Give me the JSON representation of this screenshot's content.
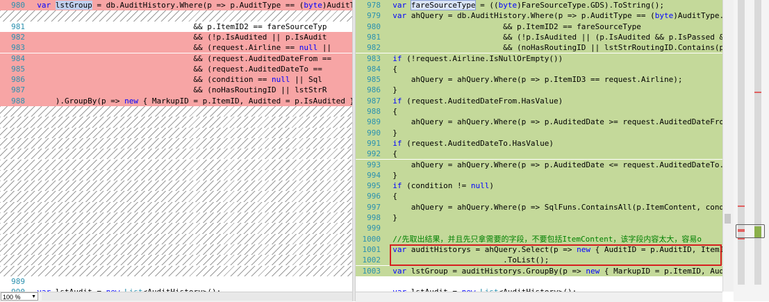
{
  "left": {
    "rows": [
      {
        "num": "980",
        "type": "del",
        "tokens": [
          [
            "  "
          ],
          [
            "var",
            "kw"
          ],
          [
            " "
          ],
          [
            "lstGroup",
            "hl"
          ],
          [
            " = db.AuditHistory.Where(p => p.AuditType == ("
          ],
          [
            "byte",
            "kw"
          ],
          [
            ")AuditTy"
          ]
        ]
      },
      {
        "num": "",
        "type": "hatch",
        "tokens": []
      },
      {
        "num": "981",
        "type": "",
        "tokens": [
          [
            "                                    && p.ItemID2 == fareSourceTyp"
          ]
        ]
      },
      {
        "num": "982",
        "type": "del",
        "tokens": [
          [
            "                                    && (!p.IsAudited || p.IsAudit"
          ]
        ]
      },
      {
        "num": "983",
        "type": "del",
        "tokens": [
          [
            "                                    && (request.Airline == "
          ],
          [
            "null",
            "kw"
          ],
          [
            " ||"
          ]
        ]
      },
      {
        "num": "984",
        "type": "del",
        "tokens": [
          [
            "                                    && (request.AuditedDateFrom =="
          ]
        ]
      },
      {
        "num": "985",
        "type": "del",
        "tokens": [
          [
            "                                    && (request.AuditedDateTo == "
          ]
        ]
      },
      {
        "num": "986",
        "type": "del",
        "tokens": [
          [
            "                                    && (condition == "
          ],
          [
            "null",
            "kw"
          ],
          [
            " || Sql"
          ]
        ]
      },
      {
        "num": "987",
        "type": "del",
        "tokens": [
          [
            "                                    && (noHasRoutingID || lstStrR"
          ]
        ]
      },
      {
        "num": "988",
        "type": "del",
        "tokens": [
          [
            "      ).GroupBy(p => "
          ],
          [
            "new",
            "kw"
          ],
          [
            " { MarkupID = p.ItemID, Audited = p.IsAudited })"
          ]
        ]
      },
      {
        "num": "",
        "type": "hatch",
        "tokens": []
      },
      {
        "num": "",
        "type": "hatch",
        "tokens": []
      },
      {
        "num": "",
        "type": "hatch",
        "tokens": []
      },
      {
        "num": "",
        "type": "hatch",
        "tokens": []
      },
      {
        "num": "",
        "type": "hatch",
        "tokens": []
      },
      {
        "num": "",
        "type": "hatch",
        "tokens": []
      },
      {
        "num": "",
        "type": "hatch",
        "tokens": []
      },
      {
        "num": "",
        "type": "hatch",
        "tokens": []
      },
      {
        "num": "",
        "type": "hatch",
        "tokens": []
      },
      {
        "num": "",
        "type": "hatch",
        "tokens": []
      },
      {
        "num": "",
        "type": "hatch",
        "tokens": []
      },
      {
        "num": "",
        "type": "hatch",
        "tokens": []
      },
      {
        "num": "",
        "type": "hatch",
        "tokens": []
      },
      {
        "num": "",
        "type": "hatch",
        "tokens": []
      },
      {
        "num": "",
        "type": "hatch",
        "tokens": []
      },
      {
        "num": "",
        "type": "hatch",
        "tokens": []
      },
      {
        "num": "989",
        "type": "",
        "tokens": [
          [
            ""
          ]
        ]
      },
      {
        "num": "990",
        "type": "",
        "tokens": [
          [
            "  "
          ],
          [
            "var",
            "kw"
          ],
          [
            " lstAudit = "
          ],
          [
            "new",
            "kw"
          ],
          [
            " "
          ],
          [
            "List",
            "ty"
          ],
          [
            "<AuditHistory>();"
          ]
        ]
      }
    ]
  },
  "right": {
    "rows": [
      {
        "num": "978",
        "type": "add",
        "tokens": [
          [
            "  "
          ],
          [
            "var",
            "kw"
          ],
          [
            " "
          ],
          [
            "fareSourceType",
            "hlbox"
          ],
          [
            " = (("
          ],
          [
            "byte",
            "kw"
          ],
          [
            ")FareSourceType.GDS).ToString();"
          ]
        ]
      },
      {
        "num": "979",
        "type": "add",
        "tokens": [
          [
            "  "
          ],
          [
            "var",
            "kw"
          ],
          [
            " ahQuery = db.AuditHistory.Where(p => p.AuditType == ("
          ],
          [
            "byte",
            "kw"
          ],
          [
            ")AuditType.Ex"
          ]
        ]
      },
      {
        "num": "980",
        "type": "add",
        "tokens": [
          [
            "                          && p.ItemID2 == fareSourceType"
          ]
        ]
      },
      {
        "num": "981",
        "type": "add",
        "tokens": [
          [
            "                          && (!p.IsAudited || (p.IsAudited && p.IsPassed && p.IsAppl"
          ]
        ]
      },
      {
        "num": "982",
        "type": "add",
        "tokens": [
          [
            "                          && (noHasRoutingID || lstStrRoutingID.Contains(p.ItemID1))"
          ]
        ]
      },
      {
        "num": "983",
        "type": "add",
        "tokens": [
          [
            "  "
          ],
          [
            "if",
            "kw"
          ],
          [
            " (!request.Airline.IsNullOrEmpty())"
          ]
        ]
      },
      {
        "num": "984",
        "type": "add",
        "tokens": [
          [
            "  {"
          ]
        ]
      },
      {
        "num": "985",
        "type": "add",
        "tokens": [
          [
            "      ahQuery = ahQuery.Where(p => p.ItemID3 == request.Airline);"
          ]
        ]
      },
      {
        "num": "986",
        "type": "add",
        "tokens": [
          [
            "  }"
          ]
        ]
      },
      {
        "num": "987",
        "type": "add",
        "tokens": [
          [
            "  "
          ],
          [
            "if",
            "kw"
          ],
          [
            " (request.AuditedDateFrom.HasValue)"
          ]
        ]
      },
      {
        "num": "988",
        "type": "add",
        "tokens": [
          [
            "  {"
          ]
        ]
      },
      {
        "num": "989",
        "type": "add",
        "tokens": [
          [
            "      ahQuery = ahQuery.Where(p => p.AuditedDate >= request.AuditedDateFrom."
          ]
        ]
      },
      {
        "num": "990",
        "type": "add",
        "tokens": [
          [
            "  }"
          ]
        ]
      },
      {
        "num": "991",
        "type": "add",
        "tokens": [
          [
            "  "
          ],
          [
            "if",
            "kw"
          ],
          [
            " (request.AuditedDateTo.HasValue)"
          ]
        ]
      },
      {
        "num": "992",
        "type": "add",
        "tokens": [
          [
            "  {"
          ]
        ]
      },
      {
        "num": "993",
        "type": "add",
        "tokens": [
          [
            "      ahQuery = ahQuery.Where(p => p.AuditedDate <= request.AuditedDateTo.Va"
          ]
        ]
      },
      {
        "num": "994",
        "type": "add",
        "tokens": [
          [
            "  }"
          ]
        ]
      },
      {
        "num": "995",
        "type": "add",
        "tokens": [
          [
            "  "
          ],
          [
            "if",
            "kw"
          ],
          [
            " (condition != "
          ],
          [
            "null",
            "kw"
          ],
          [
            ")"
          ]
        ]
      },
      {
        "num": "996",
        "type": "add",
        "tokens": [
          [
            "  {"
          ]
        ]
      },
      {
        "num": "997",
        "type": "add",
        "tokens": [
          [
            "      ahQuery = ahQuery.Where(p => SqlFuns.ContainsAll(p.ItemContent, condit"
          ]
        ]
      },
      {
        "num": "998",
        "type": "add",
        "tokens": [
          [
            "  }"
          ]
        ]
      },
      {
        "num": "999",
        "type": "add",
        "tokens": [
          [
            ""
          ]
        ]
      },
      {
        "num": "1000",
        "type": "add",
        "tokens": [
          [
            "  "
          ],
          [
            "//先取出结果，并且先只拿需要的字段，不要包括ItemContent，该字段内容太大，容易o",
            "cm"
          ]
        ]
      },
      {
        "num": "1001",
        "type": "add",
        "tokens": [
          [
            "  "
          ],
          [
            "var",
            "kw"
          ],
          [
            " auditHistorys = ahQuery.Select(p => "
          ],
          [
            "new",
            "kw"
          ],
          [
            " { AuditID = p.AuditID, ItemID"
          ]
        ]
      },
      {
        "num": "1002",
        "type": "add",
        "tokens": [
          [
            "                          .ToList();"
          ]
        ]
      },
      {
        "num": "1003",
        "type": "add",
        "tokens": [
          [
            "  "
          ],
          [
            "var",
            "kw"
          ],
          [
            " lstGroup = auditHistorys.GroupBy(p => "
          ],
          [
            "new",
            "kw"
          ],
          [
            " { MarkupID = p.ItemID, Audit"
          ]
        ]
      },
      {
        "num": "",
        "type": "",
        "tokens": [
          [
            ""
          ]
        ]
      },
      {
        "num": "",
        "type": "",
        "tokens": [
          [
            "  "
          ],
          [
            "var",
            "kw"
          ],
          [
            " lstAudit = "
          ],
          [
            "new",
            "kw"
          ],
          [
            " "
          ],
          [
            "List",
            "ty"
          ],
          [
            "<AuditHistory>();"
          ]
        ]
      }
    ]
  },
  "status": {
    "zoom": "100 %"
  },
  "colors": {
    "deleted": "#f7a5a5",
    "added": "#c4d99a",
    "highlight_box": "#d62020"
  }
}
